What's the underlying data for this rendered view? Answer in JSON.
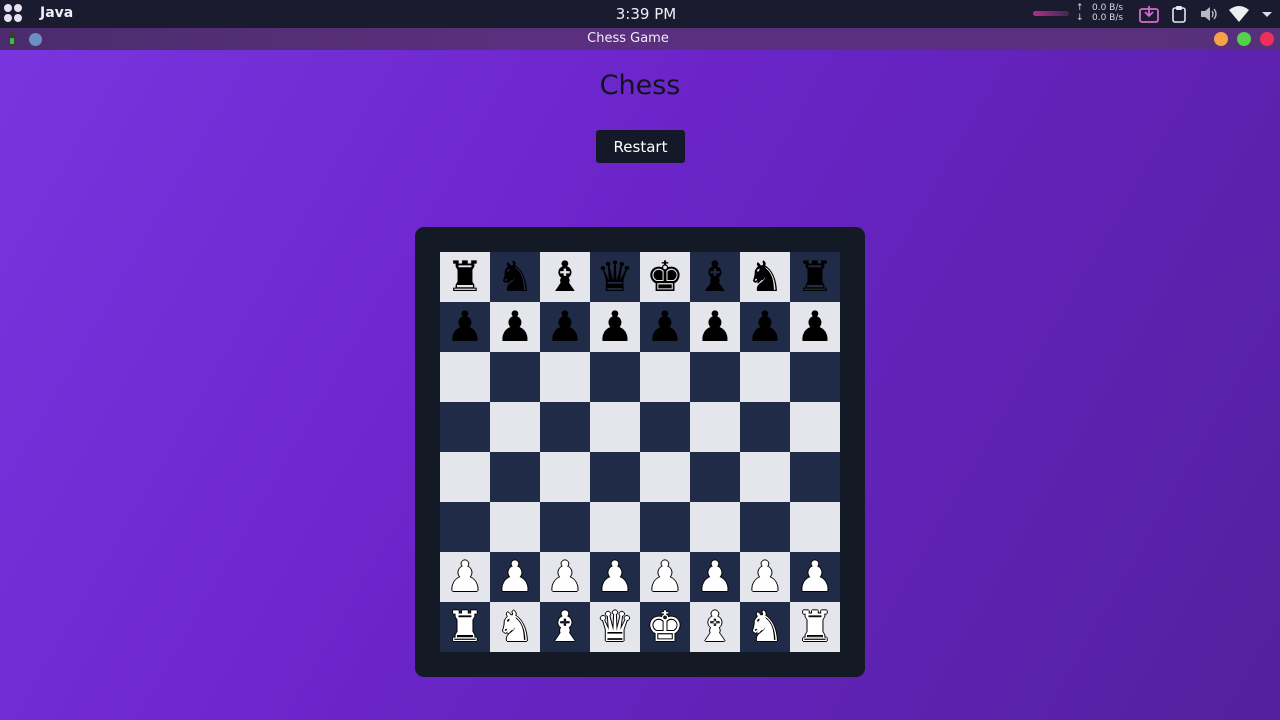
{
  "system_bar": {
    "app_name": "Java",
    "clock": "3:39 PM",
    "net_up_arrow": "↑",
    "net_down_arrow": "↓",
    "net_up": "0.0 B/s",
    "net_down": "0.0 B/s",
    "icons": [
      "apps-grid-icon",
      "download-tray-icon",
      "clipboard-icon",
      "volume-icon",
      "wifi-icon",
      "dropdown-icon"
    ]
  },
  "window": {
    "title": "Chess Game",
    "buttons": [
      "minimize",
      "maximize",
      "close"
    ]
  },
  "game": {
    "title": "Chess",
    "restart_label": "Restart"
  },
  "colors": {
    "light_square": "#e4e6ec",
    "dark_square": "#202b47",
    "frame": "#141a25"
  },
  "board": {
    "ranks": [
      [
        {
          "p": "♜",
          "c": "black",
          "n": "black-rook"
        },
        {
          "p": "♞",
          "c": "black",
          "n": "black-knight"
        },
        {
          "p": "♝",
          "c": "black",
          "n": "black-bishop"
        },
        {
          "p": "♛",
          "c": "black",
          "n": "black-queen"
        },
        {
          "p": "♚",
          "c": "black",
          "n": "black-king"
        },
        {
          "p": "♝",
          "c": "black",
          "n": "black-bishop"
        },
        {
          "p": "♞",
          "c": "black",
          "n": "black-knight"
        },
        {
          "p": "♜",
          "c": "black",
          "n": "black-rook"
        }
      ],
      [
        {
          "p": "♟",
          "c": "black",
          "n": "black-pawn"
        },
        {
          "p": "♟",
          "c": "black",
          "n": "black-pawn"
        },
        {
          "p": "♟",
          "c": "black",
          "n": "black-pawn"
        },
        {
          "p": "♟",
          "c": "black",
          "n": "black-pawn"
        },
        {
          "p": "♟",
          "c": "black",
          "n": "black-pawn"
        },
        {
          "p": "♟",
          "c": "black",
          "n": "black-pawn"
        },
        {
          "p": "♟",
          "c": "black",
          "n": "black-pawn"
        },
        {
          "p": "♟",
          "c": "black",
          "n": "black-pawn"
        }
      ],
      [
        null,
        null,
        null,
        null,
        null,
        null,
        null,
        null
      ],
      [
        null,
        null,
        null,
        null,
        null,
        null,
        null,
        null
      ],
      [
        null,
        null,
        null,
        null,
        null,
        null,
        null,
        null
      ],
      [
        null,
        null,
        null,
        null,
        null,
        null,
        null,
        null
      ],
      [
        {
          "p": "♟",
          "c": "white",
          "n": "white-pawn"
        },
        {
          "p": "♟",
          "c": "white",
          "n": "white-pawn"
        },
        {
          "p": "♟",
          "c": "white",
          "n": "white-pawn"
        },
        {
          "p": "♟",
          "c": "white",
          "n": "white-pawn"
        },
        {
          "p": "♟",
          "c": "white",
          "n": "white-pawn"
        },
        {
          "p": "♟",
          "c": "white",
          "n": "white-pawn"
        },
        {
          "p": "♟",
          "c": "white",
          "n": "white-pawn"
        },
        {
          "p": "♟",
          "c": "white",
          "n": "white-pawn"
        }
      ],
      [
        {
          "p": "♜",
          "c": "white",
          "n": "white-rook"
        },
        {
          "p": "♞",
          "c": "white",
          "n": "white-knight"
        },
        {
          "p": "♝",
          "c": "white",
          "n": "white-bishop"
        },
        {
          "p": "♛",
          "c": "white",
          "n": "white-queen"
        },
        {
          "p": "♚",
          "c": "white",
          "n": "white-king"
        },
        {
          "p": "♝",
          "c": "white",
          "n": "white-bishop"
        },
        {
          "p": "♞",
          "c": "white",
          "n": "white-knight"
        },
        {
          "p": "♜",
          "c": "white",
          "n": "white-rook"
        }
      ]
    ]
  }
}
